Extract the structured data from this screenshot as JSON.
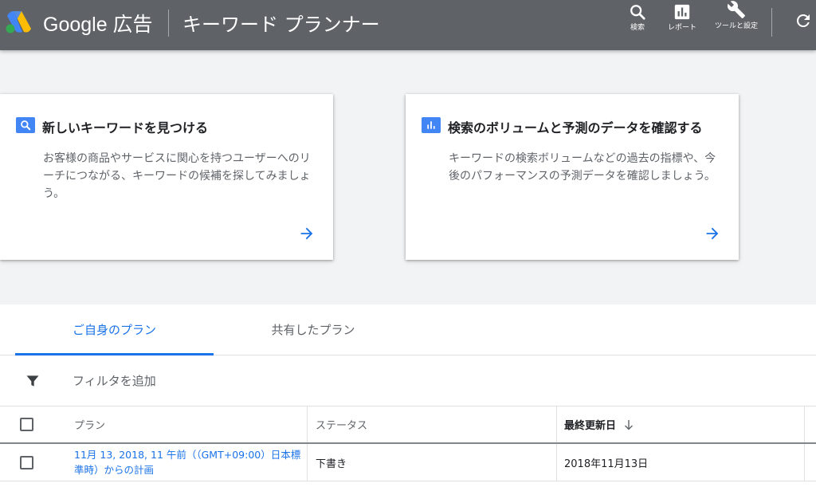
{
  "header": {
    "brand": "Google 広告",
    "page_title": "キーワード プランナー",
    "buttons": {
      "search": "検索",
      "report": "レポート",
      "tools": "ツールと設定"
    }
  },
  "cards": [
    {
      "title": "新しいキーワードを見つける",
      "description": "お客様の商品やサービスに関心を持つユーザーへのリーチにつながる、キーワードの候補を探してみましょう。",
      "icon": "search-icon"
    },
    {
      "title": "検索のボリュームと予測のデータを確認する",
      "description": "キーワードの検索ボリュームなどの過去の指標や、今後のパフォーマンスの予測データを確認しましょう。",
      "icon": "bar-chart-icon"
    }
  ],
  "tabs": {
    "own": "ご自身のプラン",
    "shared": "共有したプラン"
  },
  "filter": {
    "label": "フィルタを追加"
  },
  "table": {
    "columns": {
      "plan": "プラン",
      "status": "ステータス",
      "updated": "最終更新日"
    },
    "rows": [
      {
        "plan": "11月 13, 2018, 11 午前（（GMT+09:00）日本標準時）からの計画",
        "status": "下書き",
        "updated": "2018年11月13日"
      }
    ]
  },
  "colors": {
    "header_bg": "#5f6368",
    "accent": "#1a73e8",
    "icon_blue": "#4285f4"
  }
}
